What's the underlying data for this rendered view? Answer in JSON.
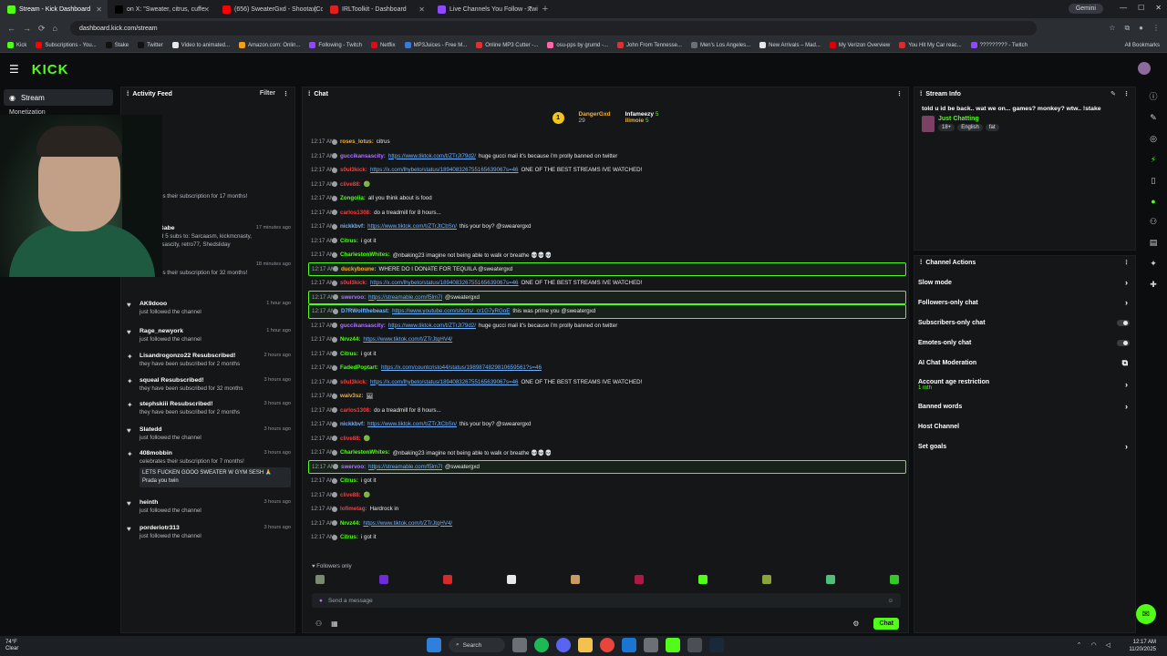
{
  "browser": {
    "tabs": [
      {
        "title": "Stream - Kick Dashboard",
        "color": "#53fc18",
        "active": true
      },
      {
        "title": "on X: \"Sweater, citrus, cuffe",
        "color": "#000000"
      },
      {
        "title": "(656) SweaterGxd - Shoota (Co",
        "color": "#ff0000"
      },
      {
        "title": "IRLToolkit - Dashboard",
        "color": "#e02020"
      },
      {
        "title": "Live Channels You Follow - Twi",
        "color": "#9146ff"
      }
    ],
    "new_tab": "+",
    "gemini": "Gemini",
    "url": "dashboard.kick.com/stream",
    "bookmarks": [
      "Kick",
      "Subscriptions - You...",
      "Stake",
      "Twitter",
      "Video to animated...",
      "Amazon.com: Onlin...",
      "Following - Twitch",
      "Netflix",
      "MP3Juices - Free M...",
      "Online MP3 Cutter -...",
      "osu-pps by grumd -...",
      "John From Tennesse...",
      "Men's Los Angeles...",
      "New Arrivals – Mad...",
      "My Verizon Overview",
      "You Hit My Car reac...",
      "????????? - Twitch"
    ],
    "all_bookmarks": "All Bookmarks"
  },
  "kick": {
    "logo": "KICK"
  },
  "leftnav": {
    "stream": "Stream",
    "monetization": "Monetization"
  },
  "feed": {
    "title": "Activity Feed",
    "filter": "Filter",
    "events": [
      {
        "icon": "",
        "name": "",
        "sub": "celebrates their subscription for 17 months!",
        "time": ""
      },
      {
        "icon": "gift",
        "name": "GamerGabe",
        "sub": "just gifted 5 subs to: Sarcaasm, kickmcnasty, guccikansascity, retro77, Shedsliday",
        "time": "17 minutes ago"
      },
      {
        "icon": "star",
        "name": "squeal",
        "sub": "celebrates their subscription for 32 months!",
        "time": "18 minutes ago"
      },
      {
        "icon": "heart",
        "name": "AK9dooo",
        "sub": "just followed the channel",
        "time": "1 hour ago"
      },
      {
        "icon": "heart",
        "name": "Rage_newyork",
        "sub": "just followed the channel",
        "time": "1 hour ago"
      },
      {
        "icon": "star",
        "name": "Lisandrogonzo22 Resubscribed!",
        "sub": "they have been subscribed for 2 months",
        "time": "2 hours ago"
      },
      {
        "icon": "star",
        "name": "squeal Resubscribed!",
        "sub": "they have been subscribed for 32 months",
        "time": "3 hours ago"
      },
      {
        "icon": "star",
        "name": "stephskiii Resubscribed!",
        "sub": "they have been subscribed for 2 months",
        "time": "3 hours ago"
      },
      {
        "icon": "heart",
        "name": "Slatedd",
        "sub": "just followed the channel",
        "time": "3 hours ago"
      },
      {
        "icon": "star",
        "name": "408mobbin",
        "sub": "celebrates their subscription for 7 months!",
        "msg": "LETS FUCKEN GOOO SWEATER W GYM SESH 🙏 Prada you twin",
        "time": "3 hours ago"
      },
      {
        "icon": "heart",
        "name": "heinth",
        "sub": "just followed the channel",
        "time": "3 hours ago"
      },
      {
        "icon": "heart",
        "name": "porderiotr313",
        "sub": "just followed the channel",
        "time": "3 hours ago"
      }
    ]
  },
  "chat": {
    "title": "Chat",
    "pinned": {
      "top": "DangerGxd",
      "top_count": "29",
      "second": "Infameezy",
      "second_count": "5",
      "third": "ilimoie",
      "third_count": "5"
    },
    "lines": [
      {
        "t": "12:17 AM",
        "u": "roses_lotus:",
        "uc": "#f2b233",
        "m": "citrus"
      },
      {
        "t": "12:17 AM",
        "u": "guccikansascity:",
        "uc": "#b075ff",
        "m": "huge gucci mail it's because i'm prolly banned on twitter",
        "l": "https://www.tiktok.com/t/ZTrJt79d2/"
      },
      {
        "t": "12:17 AM",
        "u": "s0ul3kick:",
        "uc": "#ff3b3b",
        "m": "ONE OF THE BEST STREAMS IVE WATCHED!",
        "l": "https://x.com/lhybeto/status/189408326755165639067s=46"
      },
      {
        "t": "12:17 AM",
        "u": "clive88:",
        "uc": "#ff3b3b",
        "m": "🟢"
      },
      {
        "t": "12:17 AM",
        "u": "Zongolia:",
        "uc": "#53fc18",
        "m": "all you think about is food"
      },
      {
        "t": "12:17 AM",
        "u": "carlos1308:",
        "uc": "#ff3b3b",
        "m": "do a treadmill for 8 hours..."
      },
      {
        "t": "12:17 AM",
        "u": "nickkbvf:",
        "uc": "#6db2ff",
        "m": "this your boy? @swearergxd",
        "l": "https://www.tiktok.com/t/ZTrJtCbSn/"
      },
      {
        "t": "12:17 AM",
        "u": "Citrus:",
        "uc": "#53fc18",
        "m": "i got it"
      },
      {
        "t": "12:17 AM",
        "u": "CharlestonWhites:",
        "uc": "#53fc18",
        "m": "@nbaking23 imagine not being able to walk or breathe 💀💀💀"
      },
      {
        "t": "12:17 AM",
        "u": "duckyboune:",
        "uc": "#f2b233",
        "m": "WHERE DO I DONATE FOR TEQUILA @sweatergxd",
        "hl": true
      },
      {
        "t": "12:17 AM",
        "u": "s0ul3kick:",
        "uc": "#ff3b3b",
        "m": "ONE OF THE BEST STREAMS IVE WATCHED!",
        "l": "https://x.com/lhybeto/status/189408326755165639067s=46"
      },
      {
        "t": "12:17 AM",
        "u": "swervoo:",
        "uc": "#b075ff",
        "m": "@sweatergxd",
        "l": "https://streamable.com/f5lm7l",
        "hl": true
      },
      {
        "t": "12:17 AM",
        "u": "D7RWolfthebeast:",
        "uc": "#6db2ff",
        "m": "this was prime you @sweatergxd",
        "l": "https://www.youtube.com/shorts/_cr1G7yRGoE",
        "hl": true
      },
      {
        "t": "12:17 AM",
        "u": "guccikansascity:",
        "uc": "#b075ff",
        "m": "huge gucci mail it's because i'm prolly banned on twitter",
        "l": "https://www.tiktok.com/t/ZTrJt79d2/"
      },
      {
        "t": "12:17 AM",
        "u": "Nrvz44:",
        "uc": "#53fc18",
        "m": "",
        "l": "https://www.tiktok.com/t/ZTrJtqHV4/"
      },
      {
        "t": "12:17 AM",
        "u": "Citrus:",
        "uc": "#53fc18",
        "m": "i got it"
      },
      {
        "t": "12:17 AM",
        "u": "FadedPoptart:",
        "uc": "#53fc18",
        "m": "",
        "l": "https://x.com/countcristo44/status/1989874829810659561?s=46"
      },
      {
        "t": "12:17 AM",
        "u": "s0ul3kick:",
        "uc": "#ff3b3b",
        "m": "ONE OF THE BEST STREAMS IVE WATCHED!",
        "l": "https://x.com/lhybeto/status/189408326755165639067s=46"
      },
      {
        "t": "12:17 AM",
        "u": "waiv3sz:",
        "uc": "#f2b233",
        "m": "🖼"
      },
      {
        "t": "12:17 AM",
        "u": "carlos1308:",
        "uc": "#ff3b3b",
        "m": "do a treadmill for 8 hours..."
      },
      {
        "t": "12:17 AM",
        "u": "nickkbvf:",
        "uc": "#6db2ff",
        "m": "this your boy? @swearergxd",
        "l": "https://www.tiktok.com/t/ZTrJtCbSn/"
      },
      {
        "t": "12:17 AM",
        "u": "clive88:",
        "uc": "#ff3b3b",
        "m": "🟢"
      },
      {
        "t": "12:17 AM",
        "u": "CharlestonWhites:",
        "uc": "#53fc18",
        "m": "@nbaking23 imagine not being able to walk or breathe 💀💀💀"
      },
      {
        "t": "12:17 AM",
        "u": "swervoo:",
        "uc": "#b075ff",
        "m": "@sweatergxd",
        "l": "https://streamable.com/f5lm7l",
        "hl": true
      },
      {
        "t": "12:17 AM",
        "u": "Citrus:",
        "uc": "#53fc18",
        "m": "i got it"
      },
      {
        "t": "12:17 AM",
        "u": "clive88:",
        "uc": "#ff3b3b",
        "m": "🟢"
      },
      {
        "t": "12:17 AM",
        "u": "lofimetag:",
        "uc": "#ff3b3b",
        "m": "Hardrock in"
      },
      {
        "t": "12:17 AM",
        "u": "Nrvz44:",
        "uc": "#53fc18",
        "m": "",
        "l": "https://www.tiktok.com/t/ZTrJtqHV4/"
      },
      {
        "t": "12:17 AM",
        "u": "Citrus:",
        "uc": "#53fc18",
        "m": "i got it"
      }
    ],
    "followers_only": "Followers only",
    "placeholder": "Send a message",
    "send": "Chat"
  },
  "stream_info": {
    "title": "Stream Info",
    "stream_title": "told u id be back.. wat we on... games? monkey? wtw.. !stake",
    "category": "Just Chatting",
    "tags": [
      "18+",
      "English",
      "fat"
    ]
  },
  "channel_actions": {
    "title": "Channel Actions",
    "items": [
      {
        "label": "Slow mode",
        "kind": "chevron"
      },
      {
        "label": "Followers-only chat",
        "kind": "chevron"
      },
      {
        "label": "Subscribers-only chat",
        "kind": "toggle"
      },
      {
        "label": "Emotes-only chat",
        "kind": "toggle"
      },
      {
        "label": "AI Chat Moderation",
        "kind": "external"
      },
      {
        "label": "Account age restriction",
        "sub": "1 mth",
        "kind": "chevron"
      },
      {
        "label": "Banned words",
        "kind": "chevron"
      },
      {
        "label": "Host Channel",
        "kind": "none"
      },
      {
        "label": "Set goals",
        "kind": "chevron"
      }
    ]
  },
  "taskbar": {
    "weather_temp": "74°F",
    "weather_desc": "Clear",
    "search": "Search",
    "time": "12:17 AM",
    "date": "11/20/2025"
  },
  "colors": {
    "accent": "#53fc18",
    "link": "#6db2ff",
    "bg": "#0b0d0f",
    "panel": "#141618"
  }
}
